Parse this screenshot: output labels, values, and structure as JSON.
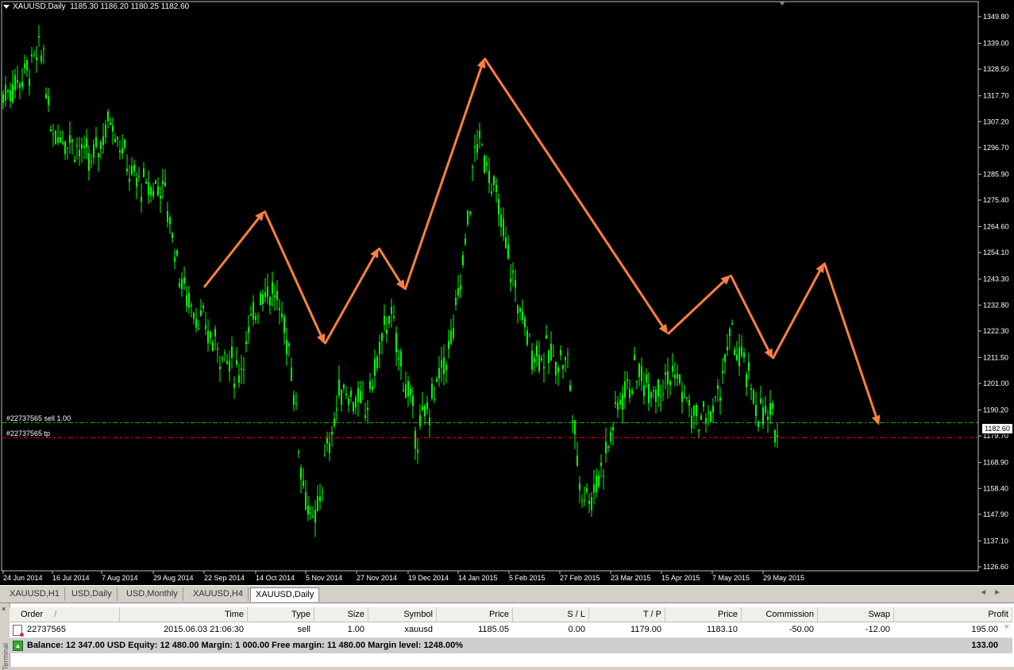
{
  "chart": {
    "title": "XAUUSD,Daily  1185.30 1186.20 1180.25 1182.60",
    "price_levels": [
      "1349.80",
      "1339.00",
      "1328.50",
      "1317.70",
      "1307.20",
      "1296.70",
      "1285.90",
      "1275.40",
      "1264.60",
      "1254.10",
      "1243.30",
      "1232.80",
      "1222.30",
      "1211.50",
      "1201.00",
      "1190.20",
      "1179.70",
      "1168.90",
      "1158.40",
      "1147.90",
      "1137.10",
      "1126.60"
    ],
    "date_labels": [
      "24 Jun 2014",
      "16 Jul 2014",
      "7 Aug 2014",
      "29 Aug 2014",
      "22 Sep 2014",
      "14 Oct 2014",
      "5 Nov 2014",
      "27 Nov 2014",
      "19 Dec 2014",
      "14 Jan 2015",
      "5 Feb 2015",
      "27 Feb 2015",
      "23 Mar 2015",
      "15 Apr 2015",
      "7 May 2015",
      "29 May 2015"
    ],
    "current_price": "1182.60",
    "sell_label": "#22737565 sell 1.00",
    "tp_label": "#22737565 tp",
    "sell_price": 1185.05,
    "tp_price": 1179.0,
    "colors": {
      "background": "#000000",
      "candles": "#00ff00",
      "arrows": "#ff8040",
      "sell_line": "#00c000",
      "tp_line": "#ff0000",
      "text": "#ffffff"
    },
    "arrow_path_prices": [
      {
        "date": "22 Sep 2014",
        "price": 1240
      },
      {
        "date": "14 Oct 2014",
        "price": 1271
      },
      {
        "date": "5 Nov 2014",
        "price": 1217
      },
      {
        "date": "27 Nov 2014",
        "price": 1256
      },
      {
        "date": "19 Dec 2014",
        "price": 1239
      },
      {
        "date": "14 Jan 2015",
        "price": 1333
      },
      {
        "date": "23 Mar 2015",
        "price": 1221
      },
      {
        "date": "7 May 2015",
        "price": 1245
      },
      {
        "date": "29 May 2015",
        "price": 1211
      },
      {
        "date": "12 Jun 2015",
        "price": 1250
      },
      {
        "date": "2 Jul 2015",
        "price": 1184
      }
    ]
  },
  "tabs": [
    {
      "label": "XAUUSD,H1",
      "active": false
    },
    {
      "label": "USD,Daily",
      "active": false
    },
    {
      "label": "USD,Monthly",
      "active": false
    },
    {
      "label": "XAUUSD,H4",
      "active": false
    },
    {
      "label": "XAUUSD,Daily",
      "active": true
    }
  ],
  "terminal": {
    "side_label": "Terminal",
    "columns": [
      "Order",
      "Time",
      "Type",
      "Size",
      "Symbol",
      "Price",
      "S / L",
      "T / P",
      "Price",
      "Commission",
      "Swap",
      "Profit"
    ],
    "sort_marker": "/",
    "rows": [
      {
        "order": "22737565",
        "time": "2015.06.03 21:06:30",
        "type": "sell",
        "size": "1.00",
        "symbol": "xauusd",
        "price": "1185.05",
        "sl": "0.00",
        "tp": "1179.00",
        "cur_price": "1183.10",
        "commission": "-50.00",
        "swap": "-12.00",
        "profit": "195.00"
      }
    ],
    "balance_line": "Balance: 12 347.00 USD  Equity: 12 480.00  Margin: 1 000.00  Free margin: 11 480.00  Margin level: 1248.00%",
    "balance_profit": "133.00"
  }
}
